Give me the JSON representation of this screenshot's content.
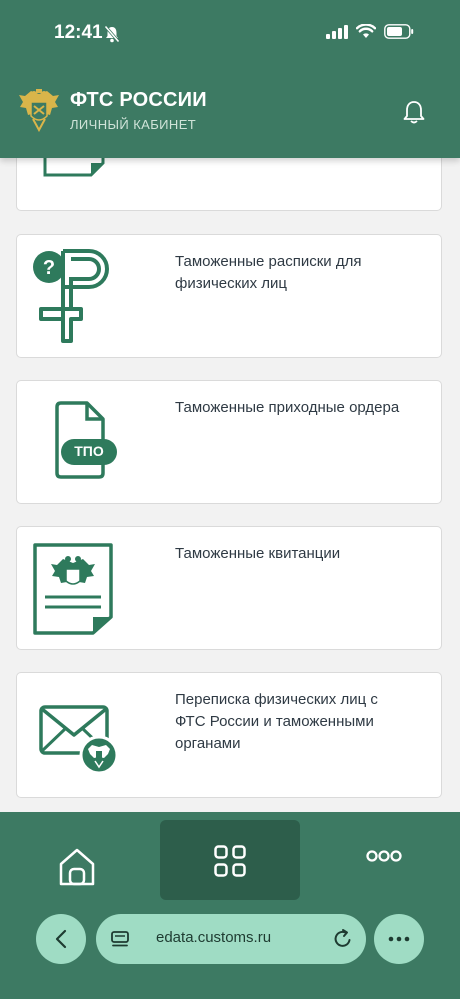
{
  "status_bar": {
    "time": "12:41"
  },
  "header": {
    "title": "ФТС РОССИИ",
    "subtitle": "ЛИЧНЫЙ КАБИНЕТ"
  },
  "cards": [
    {
      "label": ""
    },
    {
      "label": "Таможенные расписки для\nфизических лиц"
    },
    {
      "label": "Таможенные приходные ордера",
      "badge": "ТПО"
    },
    {
      "label": "Таможенные квитанции"
    },
    {
      "label": "Переписка физических лиц с\nФТС России и таможенными\nорганами"
    }
  ],
  "browser": {
    "url": "edata.customs.ru"
  },
  "colors": {
    "brand": "#3d7a63",
    "brand_dark": "#2d5e4b",
    "pill": "#9fdcc4",
    "icon": "#2e7a5c"
  }
}
